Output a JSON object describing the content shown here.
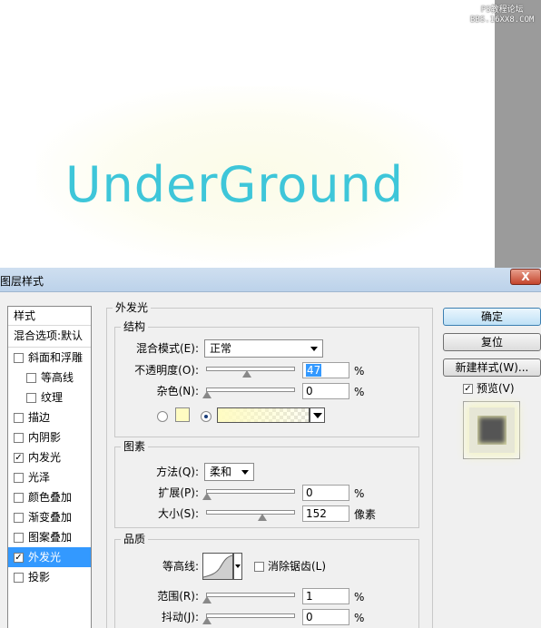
{
  "canvas": {
    "text": "UnderGround",
    "watermark_line1": "PS教程论坛",
    "watermark_line2": "BBS.16XX8.COM"
  },
  "dialog": {
    "title": "图层样式",
    "close_label": "X"
  },
  "styles_list": {
    "header": "样式",
    "blend_options": "混合选项:默认",
    "items": [
      {
        "label": "斜面和浮雕",
        "checked": false,
        "indent": false
      },
      {
        "label": "等高线",
        "checked": false,
        "indent": true
      },
      {
        "label": "纹理",
        "checked": false,
        "indent": true
      },
      {
        "label": "描边",
        "checked": false,
        "indent": false
      },
      {
        "label": "内阴影",
        "checked": false,
        "indent": false
      },
      {
        "label": "内发光",
        "checked": true,
        "indent": false
      },
      {
        "label": "光泽",
        "checked": false,
        "indent": false
      },
      {
        "label": "颜色叠加",
        "checked": false,
        "indent": false
      },
      {
        "label": "渐变叠加",
        "checked": false,
        "indent": false
      },
      {
        "label": "图案叠加",
        "checked": false,
        "indent": false
      },
      {
        "label": "外发光",
        "checked": true,
        "indent": false,
        "selected": true
      },
      {
        "label": "投影",
        "checked": false,
        "indent": false
      }
    ]
  },
  "outer_glow": {
    "title": "外发光",
    "structure": {
      "title": "结构",
      "blend_mode_label": "混合模式(E):",
      "blend_mode_value": "正常",
      "opacity_label": "不透明度(O):",
      "opacity_value": "47",
      "noise_label": "杂色(N):",
      "noise_value": "0",
      "percent": "%",
      "glow_color": "#fffcc2"
    },
    "elements": {
      "title": "图素",
      "technique_label": "方法(Q):",
      "technique_value": "柔和",
      "spread_label": "扩展(P):",
      "spread_value": "0",
      "size_label": "大小(S):",
      "size_value": "152",
      "size_unit": "像素",
      "percent": "%"
    },
    "quality": {
      "title": "品质",
      "contour_label": "等高线:",
      "antialias_label": "消除锯齿(L)",
      "antialias_checked": false,
      "range_label": "范围(R):",
      "range_value": "1",
      "jitter_label": "抖动(J):",
      "jitter_value": "0",
      "percent": "%"
    }
  },
  "buttons": {
    "ok": "确定",
    "reset": "复位",
    "new_style": "新建样式(W)...",
    "preview_label": "预览(V)",
    "preview_checked": true
  }
}
